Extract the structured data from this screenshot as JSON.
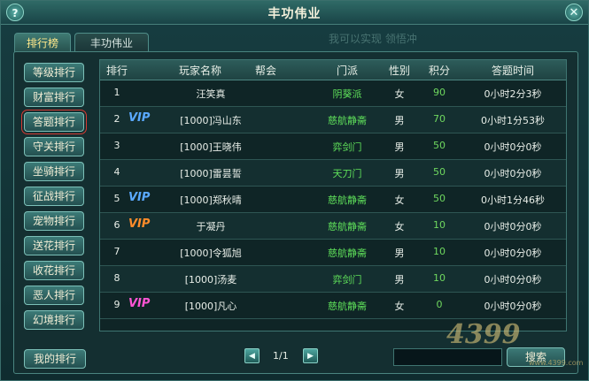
{
  "window": {
    "title": "丰功伟业",
    "help_glyph": "?",
    "close_glyph": "✕"
  },
  "tabs": [
    {
      "label": "排行榜"
    },
    {
      "label": "丰功伟业"
    }
  ],
  "watermark": "我可以实现 领悟冲",
  "sidebar": {
    "items": [
      {
        "label": "等级排行"
      },
      {
        "label": "财富排行"
      },
      {
        "label": "答题排行"
      },
      {
        "label": "守关排行"
      },
      {
        "label": "坐骑排行"
      },
      {
        "label": "征战排行"
      },
      {
        "label": "宠物排行"
      },
      {
        "label": "送花排行"
      },
      {
        "label": "收花排行"
      },
      {
        "label": "恶人排行"
      },
      {
        "label": "幻境排行"
      }
    ],
    "selected_index": 2,
    "selected_color": "#d63a33",
    "my_rank_label": "我的排行"
  },
  "table": {
    "headers": [
      "排行",
      "玩家名称",
      "帮会",
      "门派",
      "性别",
      "积分",
      "答题时间"
    ],
    "rows": [
      {
        "rank": "1",
        "vip": "",
        "name": "汪笑真",
        "guild": "",
        "sect": "阴葵派",
        "gender": "女",
        "score": "90",
        "time": "0小时2分3秒"
      },
      {
        "rank": "2",
        "vip": "VIP",
        "vip_color": "blue",
        "name": "[1000]冯山东",
        "guild": "",
        "sect": "慈航静斋",
        "gender": "男",
        "score": "70",
        "time": "0小时1分53秒"
      },
      {
        "rank": "3",
        "vip": "",
        "name": "[1000]王晓伟",
        "guild": "",
        "sect": "弈剑门",
        "gender": "男",
        "score": "50",
        "time": "0小时0分0秒"
      },
      {
        "rank": "4",
        "vip": "",
        "name": "[1000]雷昙誓",
        "guild": "",
        "sect": "天刀门",
        "gender": "男",
        "score": "50",
        "time": "0小时0分0秒"
      },
      {
        "rank": "5",
        "vip": "VIP",
        "vip_color": "blue",
        "name": "[1000]郑秋晴",
        "guild": "",
        "sect": "慈航静斋",
        "gender": "女",
        "score": "50",
        "time": "0小时1分46秒"
      },
      {
        "rank": "6",
        "vip": "VIP",
        "vip_color": "orange",
        "name": "于凝丹",
        "guild": "",
        "sect": "慈航静斋",
        "gender": "女",
        "score": "10",
        "time": "0小时0分0秒"
      },
      {
        "rank": "7",
        "vip": "",
        "name": "[1000]令狐旭",
        "guild": "",
        "sect": "慈航静斋",
        "gender": "男",
        "score": "10",
        "time": "0小时0分0秒"
      },
      {
        "rank": "8",
        "vip": "",
        "name": "[1000]汤麦",
        "guild": "",
        "sect": "弈剑门",
        "gender": "男",
        "score": "10",
        "time": "0小时0分0秒"
      },
      {
        "rank": "9",
        "vip": "VIP",
        "vip_color": "pink",
        "name": "[1000]凡心",
        "guild": "",
        "sect": "慈航静斋",
        "gender": "女",
        "score": "0",
        "time": "0小时0分0秒"
      }
    ]
  },
  "pager": {
    "text": "1/1",
    "prev_glyph": "◀",
    "next_glyph": "▶"
  },
  "search": {
    "value": "",
    "button_label": "搜索"
  },
  "logo": {
    "text": "4399",
    "sub": "www.4399.com"
  }
}
